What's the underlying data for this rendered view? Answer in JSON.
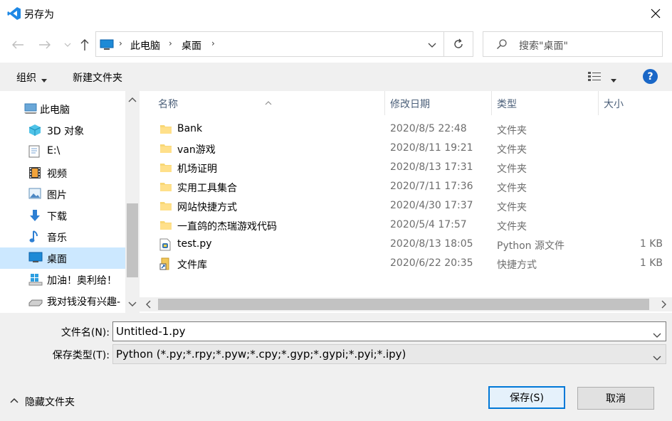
{
  "window": {
    "title": "另存为",
    "accent": "#0078d7",
    "vscode_blue": "#1e88e5"
  },
  "nav": {
    "breadcrumb": [
      "此电脑",
      "桌面"
    ],
    "search_placeholder": "搜索\"桌面\""
  },
  "toolbar": {
    "organize_label": "组织",
    "new_folder_label": "新建文件夹",
    "help_label": "?"
  },
  "sidebar": {
    "items": [
      {
        "label": "此电脑",
        "icon": "computer-icon"
      },
      {
        "label": "3D 对象",
        "icon": "cube-3d-icon"
      },
      {
        "label": "E:\\",
        "icon": "drive-icon"
      },
      {
        "label": "视频",
        "icon": "video-icon"
      },
      {
        "label": "图片",
        "icon": "picture-icon"
      },
      {
        "label": "下载",
        "icon": "download-icon"
      },
      {
        "label": "音乐",
        "icon": "music-icon"
      },
      {
        "label": "桌面",
        "icon": "desktop-icon"
      },
      {
        "label": "加油！奥利给！",
        "icon": "windows-drive-icon"
      },
      {
        "label": "我对钱没有兴趣-",
        "icon": "usb-drive-icon"
      }
    ]
  },
  "columns": {
    "name": "名称",
    "date": "修改日期",
    "type": "类型",
    "size": "大小"
  },
  "files": [
    {
      "name": "Bank",
      "date": "2020/8/5 22:48",
      "type": "文件夹",
      "size": "",
      "icon": "folder-icon"
    },
    {
      "name": "van游戏",
      "date": "2020/8/11 19:21",
      "type": "文件夹",
      "size": "",
      "icon": "folder-icon"
    },
    {
      "name": "机场证明",
      "date": "2020/8/13 17:31",
      "type": "文件夹",
      "size": "",
      "icon": "folder-icon"
    },
    {
      "name": "实用工具集合",
      "date": "2020/7/11 17:36",
      "type": "文件夹",
      "size": "",
      "icon": "folder-icon"
    },
    {
      "name": "网站快捷方式",
      "date": "2020/4/30 17:37",
      "type": "文件夹",
      "size": "",
      "icon": "folder-icon"
    },
    {
      "name": "一直鸽的杰瑞游戏代码",
      "date": "2020/5/4 17:57",
      "type": "文件夹",
      "size": "",
      "icon": "folder-icon"
    },
    {
      "name": "test.py",
      "date": "2020/8/13 18:05",
      "type": "Python 源文件",
      "size": "1 KB",
      "icon": "python-file-icon"
    },
    {
      "name": "文件库",
      "date": "2020/6/22 20:35",
      "type": "快捷方式",
      "size": "1 KB",
      "icon": "shortcut-icon"
    }
  ],
  "form": {
    "filename_label": "文件名(N):",
    "filename_value": "Untitled-1.py",
    "filetype_label": "保存类型(T):",
    "filetype_value": "Python (*.py;*.rpy;*.pyw;*.cpy;*.gyp;*.gypi;*.pyi;*.ipy)"
  },
  "footer": {
    "hide_folders_label": "隐藏文件夹",
    "save_label": "保存(S)",
    "cancel_label": "取消"
  }
}
